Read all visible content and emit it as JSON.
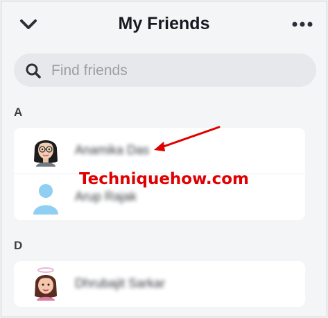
{
  "header": {
    "title": "My Friends",
    "back_icon": "chevron-down-icon",
    "more_icon": "more-horizontal-icon"
  },
  "search": {
    "placeholder": "Find friends",
    "value": "",
    "icon": "search-icon"
  },
  "sections": [
    {
      "letter": "A",
      "friends": [
        {
          "name": "Anamika Das",
          "avatar": "bitmoji-avatar-glasses"
        },
        {
          "name": "Arup Rajak",
          "avatar": "default-person-avatar"
        }
      ]
    },
    {
      "letter": "D",
      "friends": [
        {
          "name": "Dhrubajit Sarkar",
          "avatar": "bitmoji-avatar-halo"
        }
      ]
    }
  ],
  "watermark": "Techniquehow.com",
  "colors": {
    "title": "#16191f",
    "search_bg": "#e6e8eb",
    "placeholder": "#9aa0a6",
    "watermark": "#e00000",
    "default_avatar": "#8fd0f2"
  }
}
